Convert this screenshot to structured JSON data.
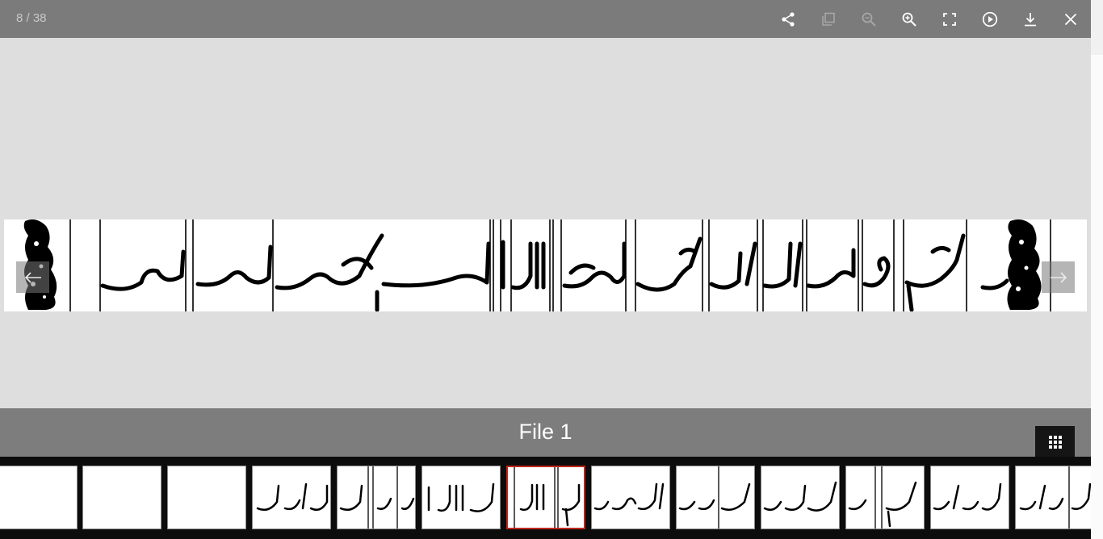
{
  "viewer": {
    "counter": "8 / 38",
    "caption": "File 1"
  },
  "toolbar": {
    "buttons": [
      {
        "icon": "share-icon",
        "enabled": true
      },
      {
        "icon": "copy-icon",
        "enabled": false
      },
      {
        "icon": "zoom-out-icon",
        "enabled": false
      },
      {
        "icon": "zoom-in-icon",
        "enabled": true
      },
      {
        "icon": "fullscreen-icon",
        "enabled": true
      },
      {
        "icon": "play-icon",
        "enabled": true
      },
      {
        "icon": "download-icon",
        "enabled": true
      },
      {
        "icon": "close-icon",
        "enabled": true
      }
    ]
  },
  "thumbnails": {
    "count_visible": 13,
    "active_index": 6
  },
  "colors": {
    "toolbar": "#7b7b7b",
    "stage": "#dedede",
    "caption_bar": "#7d7d7d",
    "thumb_strip": "#0c0c0c",
    "active_border": "#c0271c",
    "icon_enabled": "#ffffff",
    "icon_disabled": "#a6a6a6"
  }
}
